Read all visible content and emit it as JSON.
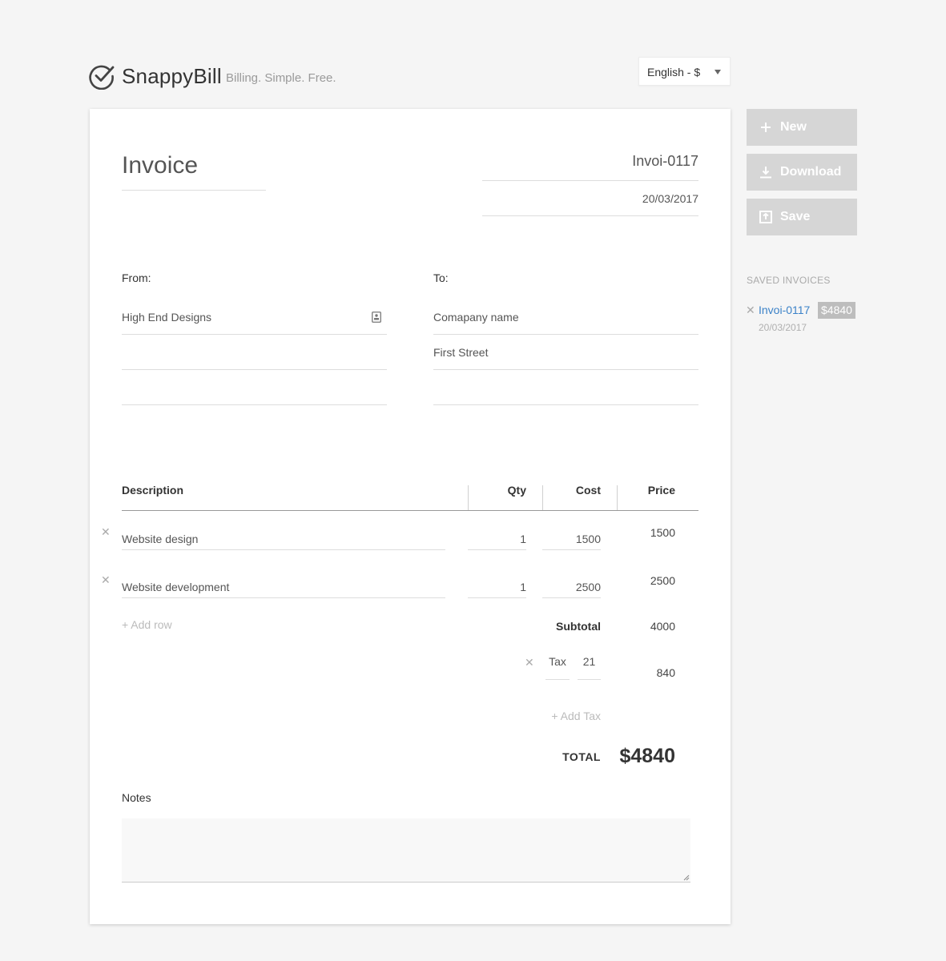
{
  "header": {
    "brand": "SnappyBill",
    "tagline": "Billing. Simple. Free.",
    "language_select": "English - $"
  },
  "invoice": {
    "title": "Invoice",
    "number": "Invoi-0117",
    "date": "20/03/2017",
    "from_label": "From:",
    "to_label": "To:",
    "from_lines": [
      "High End Designs",
      "",
      ""
    ],
    "to_lines": [
      "Comapany name",
      "First Street",
      ""
    ]
  },
  "table": {
    "headers": {
      "description": "Description",
      "qty": "Qty",
      "cost": "Cost",
      "price": "Price"
    },
    "rows": [
      {
        "description": "Website design",
        "qty": "1",
        "cost": "1500",
        "price": "1500"
      },
      {
        "description": "Website development",
        "qty": "1",
        "cost": "2500",
        "price": "2500"
      }
    ],
    "remove_glyph": "✕",
    "add_row": "+ Add row"
  },
  "totals": {
    "subtotal_label": "Subtotal",
    "subtotal_value": "4000",
    "tax_label": "Tax",
    "tax_rate": "21",
    "tax_value": "840",
    "add_tax": "+ Add Tax",
    "total_label": "TOTAL",
    "total_value": "$4840"
  },
  "notes": {
    "label": "Notes",
    "value": ""
  },
  "sidebar": {
    "new_label": "New",
    "download_label": "Download",
    "save_label": "Save",
    "saved_heading": "SAVED INVOICES",
    "saved": [
      {
        "number": "Invoi-0117",
        "amount": "$4840",
        "date": "20/03/2017"
      }
    ]
  },
  "colors": {
    "background": "#f5f5f5",
    "button": "#d6d6d6",
    "link": "#3b82c8",
    "badge": "#bdbdbd"
  },
  "icons": [
    "check-circle-icon",
    "contact-card-icon",
    "plus-icon",
    "download-icon",
    "save-icon",
    "remove-icon",
    "dropdown-caret-icon",
    "resize-grip-icon"
  ]
}
